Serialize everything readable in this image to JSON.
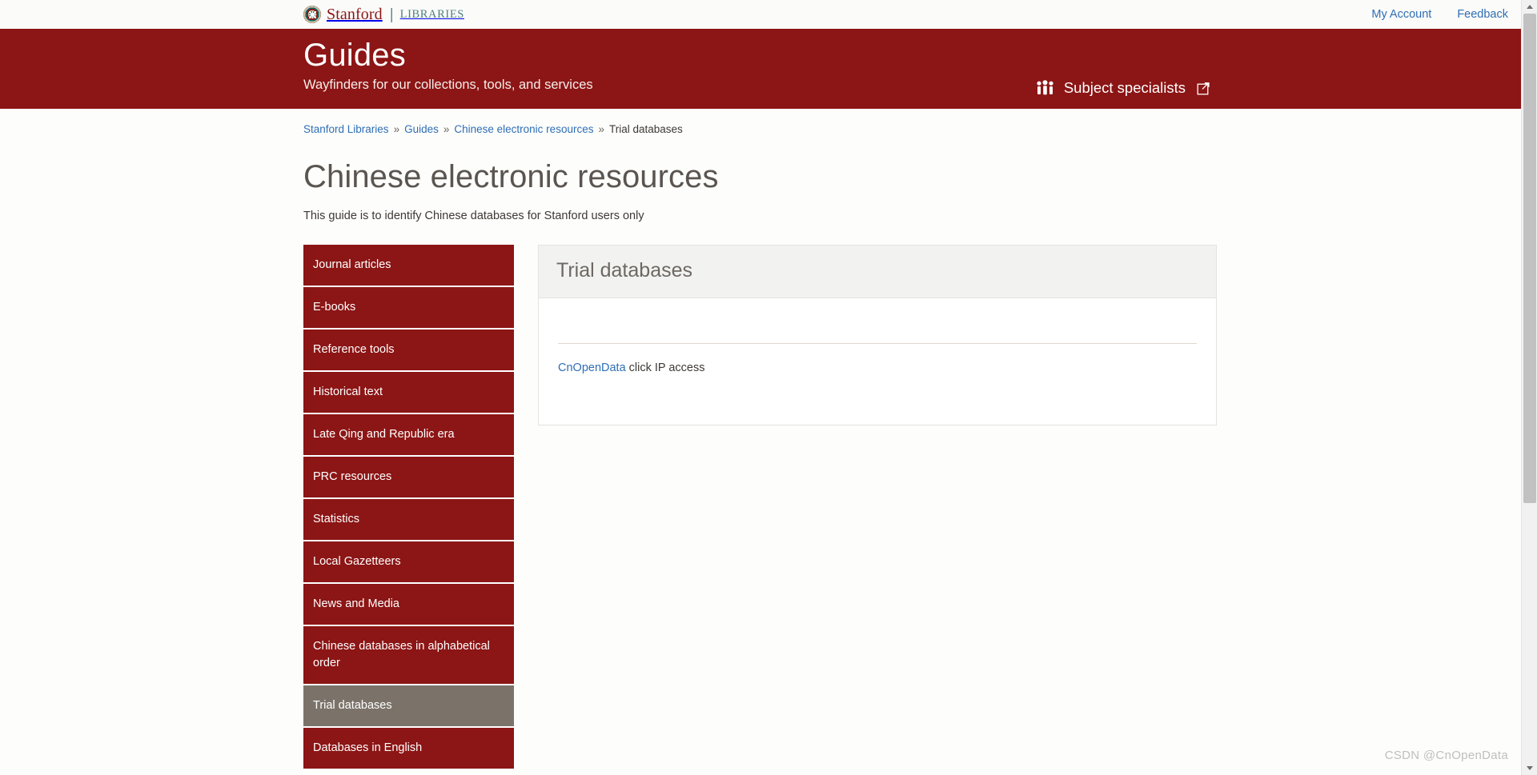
{
  "brand": {
    "logo_word": "Stanford",
    "logo_divider": "|",
    "logo_sub": "LIBRARIES",
    "seal_icon": "stanford-seal-icon"
  },
  "utility": {
    "links": [
      {
        "label": "My Account"
      },
      {
        "label": "Feedback"
      }
    ]
  },
  "banner": {
    "title": "Guides",
    "tagline": "Wayfinders for our collections, tools, and services",
    "subject_specialists": {
      "label": "Subject specialists",
      "people_icon": "people-icon",
      "external_icon": "external-link-icon"
    },
    "background_color": "#8c1515"
  },
  "breadcrumb": {
    "items": [
      {
        "label": "Stanford Libraries",
        "is_link": true
      },
      {
        "label": "Guides",
        "is_link": true
      },
      {
        "label": "Chinese electronic resources",
        "is_link": true
      },
      {
        "label": "Trial databases",
        "is_link": false
      }
    ],
    "separator": "»"
  },
  "page": {
    "title": "Chinese electronic resources",
    "description": "This guide is to identify Chinese databases for Stanford users only"
  },
  "sidebar": {
    "items": [
      {
        "label": "Journal articles",
        "active": false
      },
      {
        "label": "E-books",
        "active": false
      },
      {
        "label": "Reference tools",
        "active": false
      },
      {
        "label": "Historical text",
        "active": false
      },
      {
        "label": "Late Qing and Republic era",
        "active": false
      },
      {
        "label": "PRC resources",
        "active": false
      },
      {
        "label": "Statistics",
        "active": false
      },
      {
        "label": "Local Gazetteers",
        "active": false
      },
      {
        "label": "News and Media",
        "active": false
      },
      {
        "label": "Chinese databases in alphabetical order",
        "active": false
      },
      {
        "label": "Trial databases",
        "active": true
      },
      {
        "label": "Databases in English",
        "active": false
      }
    ],
    "active_color": "#7b736a",
    "item_color": "#8c1515"
  },
  "panel": {
    "heading": "Trial databases",
    "entries": [
      {
        "link_label": "CnOpenData",
        "trailing_text": " click IP access"
      }
    ]
  },
  "watermark": {
    "text": "CSDN @CnOpenData"
  }
}
